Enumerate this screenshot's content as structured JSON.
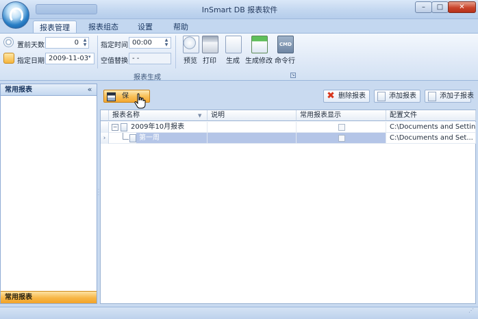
{
  "window": {
    "title": "InSmart DB 报表软件",
    "minimize": "–",
    "maximize": "□",
    "close": "✕"
  },
  "qat": {
    "text": ""
  },
  "ribbon": {
    "tabs": [
      "报表管理",
      "报表组态",
      "设置",
      "帮助"
    ],
    "active_tab": "报表管理",
    "fields": {
      "days_label": "置前天数",
      "days_value": "0",
      "date_label": "指定日期",
      "date_value": "2009-11-03",
      "time_label": "指定时间",
      "time_value": "00:00",
      "null_label": "空值替换",
      "null_value": "- -"
    },
    "buttons": [
      "预览",
      "打印",
      "生成",
      "生成修改",
      "命令行"
    ],
    "cmd_icon_text": "CMD",
    "group_caption": "报表生成"
  },
  "left_panel": {
    "header": "常用报表",
    "footer": "常用报表",
    "collapse": "«"
  },
  "toolbar": {
    "save": "保",
    "delete": "删除报表",
    "add": "添加报表",
    "add_sub": "添加子报表"
  },
  "grid": {
    "columns": [
      "报表名称",
      "说明",
      "常用报表显示",
      "配置文件"
    ],
    "rows": [
      {
        "name": "2009年10月报表",
        "desc": "",
        "common": false,
        "config": "C:\\Documents and Setting...",
        "level": 0,
        "selected": false
      },
      {
        "name": "第一周",
        "desc": "",
        "common": false,
        "config": "C:\\Documents and Set... ···",
        "level": 1,
        "selected": true
      }
    ]
  },
  "colors": {
    "accent": "#f8c15a",
    "selection": "#b4c5e7",
    "panel_border": "#8fabd4"
  },
  "icons": [
    "app-orb-icon",
    "clock-icon",
    "calendar-icon",
    "magnifier-icon",
    "printer-icon",
    "document-icon",
    "document-edit-icon",
    "cmd-icon",
    "save-icon",
    "delete-icon",
    "add-icon",
    "add-sub-icon",
    "cursor-icon"
  ]
}
